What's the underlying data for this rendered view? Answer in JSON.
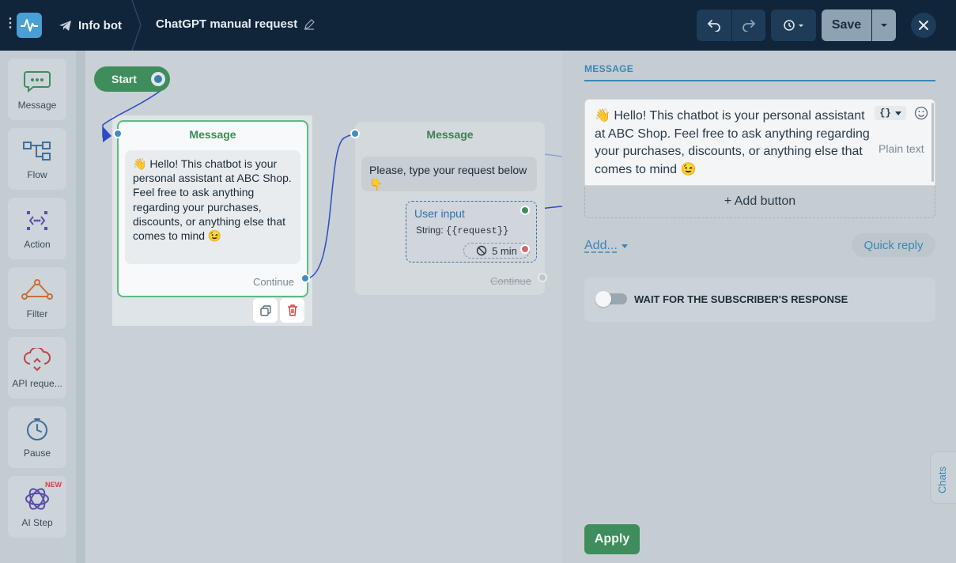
{
  "topbar": {
    "bot_name": "Info bot",
    "flow_title": "ChatGPT manual request",
    "save_label": "Save"
  },
  "sidebar": {
    "items": [
      {
        "label": "Message",
        "icon": "chat-bubble-icon"
      },
      {
        "label": "Flow",
        "icon": "flow-icon"
      },
      {
        "label": "Action",
        "icon": "action-icon"
      },
      {
        "label": "Filter",
        "icon": "filter-icon"
      },
      {
        "label": "API reque...",
        "icon": "cloud-api-icon"
      },
      {
        "label": "Pause",
        "icon": "clock-icon"
      },
      {
        "label": "AI Step",
        "icon": "ai-icon",
        "badge": "NEW"
      }
    ]
  },
  "canvas": {
    "start_label": "Start",
    "node1": {
      "title": "Message",
      "text": "👋 Hello! This chatbot is your personal assistant at ABC Shop. Feel free to ask anything regarding your purchases, discounts, or anything else that comes to mind 😉",
      "continue": "Continue"
    },
    "node2": {
      "title": "Message",
      "text": "Please, type your request below 👇",
      "user_input_title": "User input",
      "user_input_type": "String:",
      "user_input_var": "{{request}}",
      "timeout": "5 min",
      "continue": "Continue"
    }
  },
  "panel": {
    "tab": "MESSAGE",
    "message_text": "👋 Hello! This chatbot is your personal assistant at ABC Shop. Feel free to ask anything regarding your purchases, discounts, or anything else that comes to mind 😉",
    "format": "Plain text",
    "braces": "{}",
    "add_button": "+ Add button",
    "add_link": "Add...",
    "quick_reply": "Quick reply",
    "wait_label": "WAIT FOR THE SUBSCRIBER'S RESPONSE",
    "wait_enabled": false,
    "chats_tab": "Chats",
    "apply": "Apply"
  },
  "colors": {
    "topbar": "#10243a",
    "accent_green": "#3f8d5c",
    "accent_blue": "#3b87b6",
    "edge_blue": "#2f49c4"
  }
}
